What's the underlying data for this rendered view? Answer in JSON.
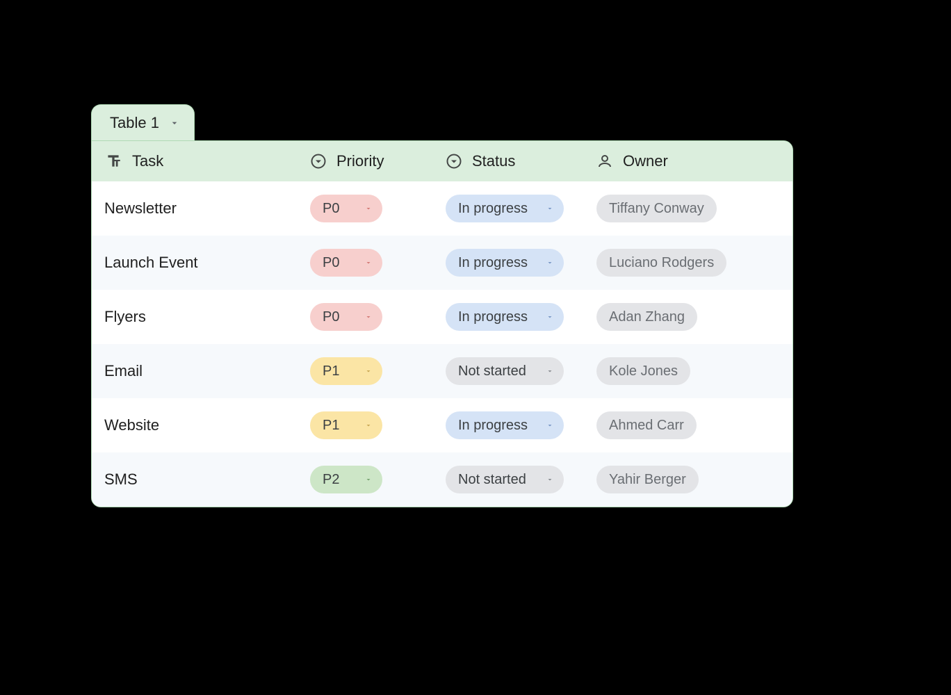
{
  "tab": {
    "label": "Table 1"
  },
  "headers": {
    "task": "Task",
    "priority": "Priority",
    "status": "Status",
    "owner": "Owner"
  },
  "colors": {
    "priority": {
      "P0": "p-red",
      "P1": "p-yellow",
      "P2": "p-green"
    },
    "status": {
      "In progress": "s-blue",
      "Not started": "s-grey"
    },
    "header_bg": "#dbeedd",
    "border": "#afd9b4"
  },
  "rows": [
    {
      "task": "Newsletter",
      "priority": "P0",
      "status": "In progress",
      "owner": "Tiffany Conway"
    },
    {
      "task": "Launch Event",
      "priority": "P0",
      "status": "In progress",
      "owner": "Luciano Rodgers"
    },
    {
      "task": "Flyers",
      "priority": "P0",
      "status": "In progress",
      "owner": "Adan Zhang"
    },
    {
      "task": "Email",
      "priority": "P1",
      "status": "Not started",
      "owner": "Kole Jones"
    },
    {
      "task": "Website",
      "priority": "P1",
      "status": "In progress",
      "owner": "Ahmed Carr"
    },
    {
      "task": "SMS",
      "priority": "P2",
      "status": "Not started",
      "owner": "Yahir Berger"
    }
  ]
}
